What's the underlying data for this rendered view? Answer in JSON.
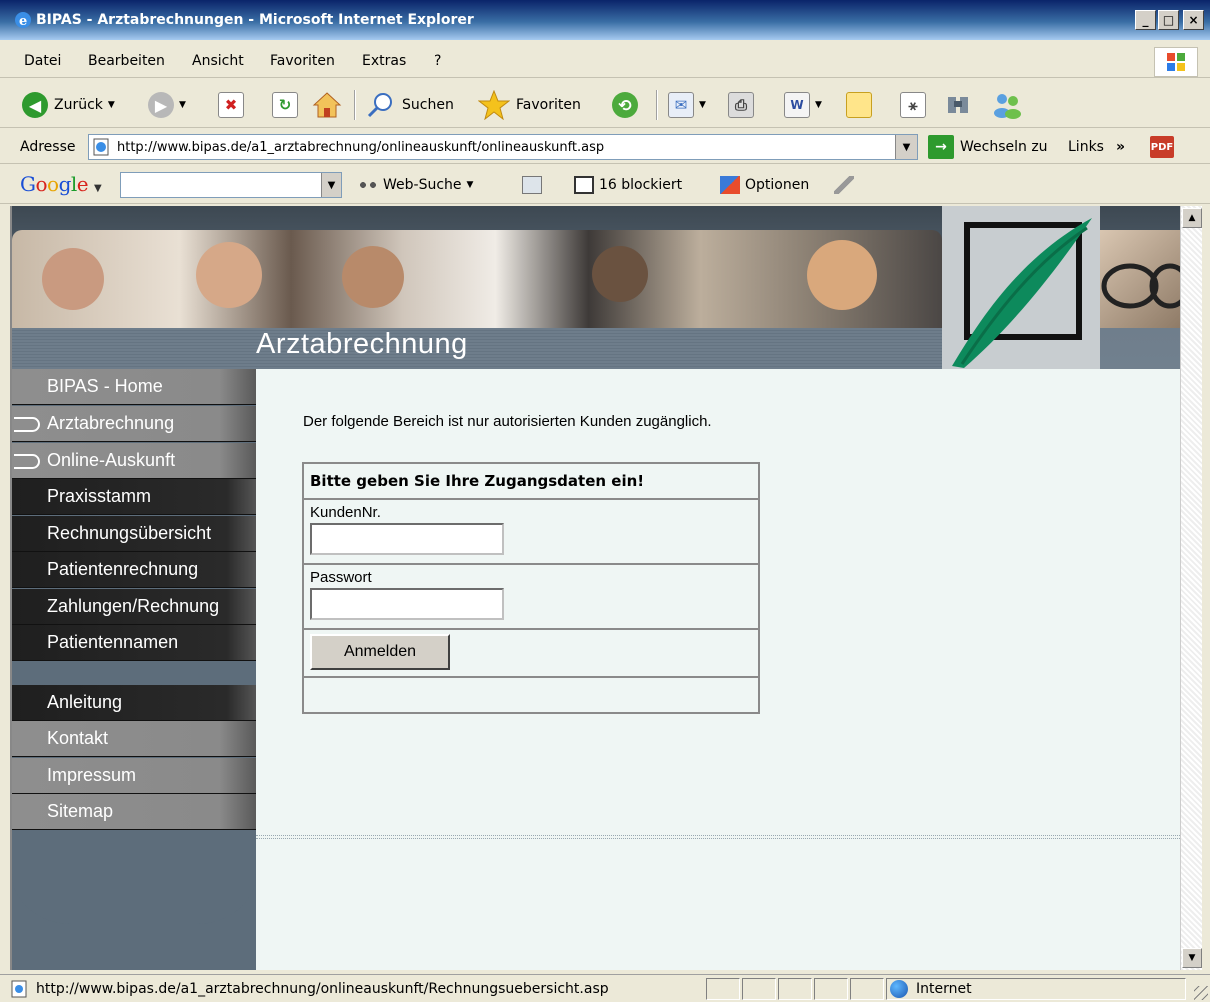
{
  "window": {
    "title": "BIPAS - Arztabrechnungen - Microsoft Internet Explorer",
    "buttons": [
      "_",
      "□",
      "×"
    ]
  },
  "menu": [
    "Datei",
    "Bearbeiten",
    "Ansicht",
    "Favoriten",
    "Extras",
    "?"
  ],
  "toolbar": {
    "back_label": "Zurück",
    "search_label": "Suchen",
    "favorites_label": "Favoriten"
  },
  "address": {
    "label": "Adresse",
    "url": "http://www.bipas.de/a1_arztabrechnung/onlineauskunft/onlineauskunft.asp",
    "go_label": "Wechseln zu",
    "links_label": "Links"
  },
  "googlebar": {
    "logo": [
      "G",
      "o",
      "o",
      "g",
      "l",
      "e"
    ],
    "web_search_label": "Web-Suche",
    "blocked_label": "16 blockiert",
    "options_label": "Optionen"
  },
  "banner": {
    "title": "Arztabrechnung"
  },
  "nav": {
    "items": [
      {
        "label": "BIPAS - Home"
      },
      {
        "label": "Arztabrechnung"
      },
      {
        "label": "Online-Auskunft"
      },
      {
        "label": "Praxisstamm"
      },
      {
        "label": "Rechnungsübersicht"
      },
      {
        "label": "Patientenrechnung"
      },
      {
        "label": "Zahlungen/Rechnung"
      },
      {
        "label": "Patientennamen"
      },
      {
        "label": "Anleitung"
      },
      {
        "label": "Kontakt"
      },
      {
        "label": "Impressum"
      },
      {
        "label": "Sitemap"
      }
    ]
  },
  "main": {
    "intro": "Der folgende Bereich ist nur autorisierten Kunden zugänglich.",
    "login": {
      "heading": "Bitte geben Sie Ihre Zugangsdaten ein!",
      "customer_label": "KundenNr.",
      "customer_value": "",
      "password_label": "Passwort",
      "password_value": "",
      "submit_label": "Anmelden"
    }
  },
  "status": {
    "url": "http://www.bipas.de/a1_arztabrechnung/onlineauskunft/Rechnungsuebersicht.asp",
    "zone": "Internet"
  }
}
